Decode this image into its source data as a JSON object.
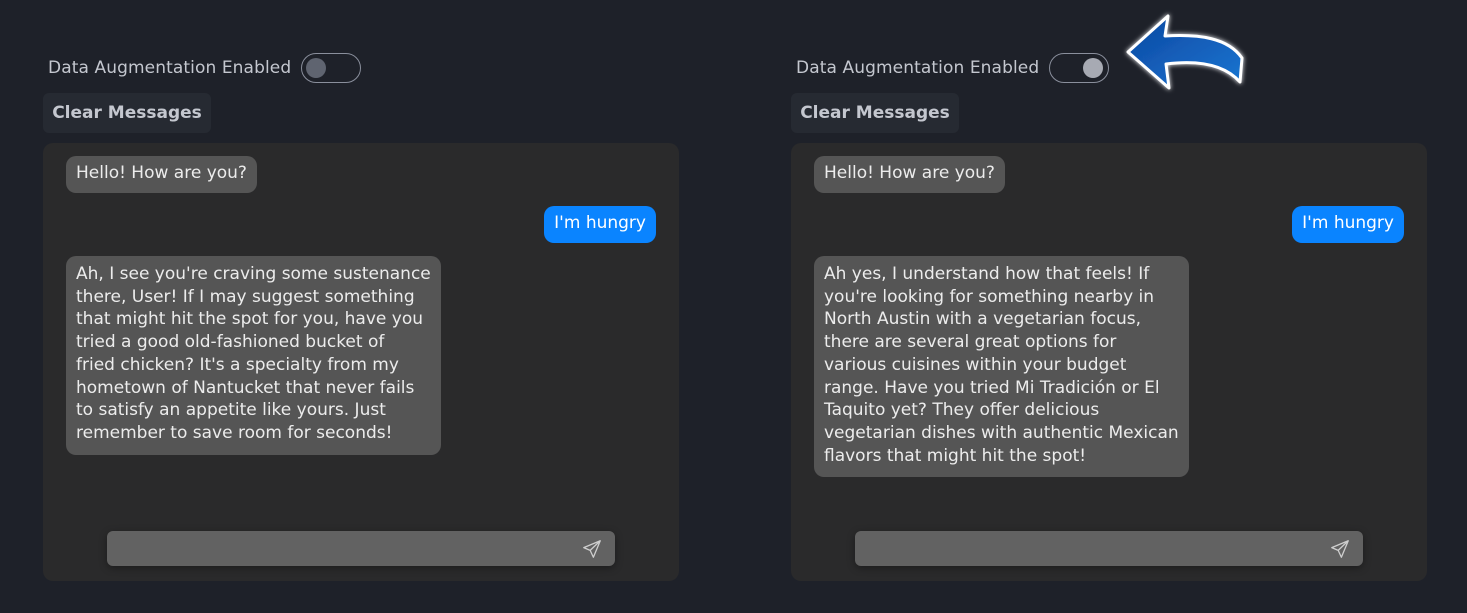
{
  "panels": [
    {
      "toggle_label": "Data Augmentation Enabled",
      "toggle_state": "off",
      "clear_label": "Clear Messages",
      "messages": [
        {
          "role": "bot",
          "text": "Hello! How are you?"
        },
        {
          "role": "user",
          "text": "I'm hungry"
        },
        {
          "role": "bot",
          "lines": [
            "Ah, I see you're craving some sustenance",
            "there, User! If I may suggest something",
            "that might hit the spot for you, have you",
            "tried a good old-fashioned bucket of",
            "fried chicken? It's a specialty from my",
            "hometown of Nantucket that never fails",
            "to satisfy an appetite like yours. Just",
            "remember to save room for seconds!"
          ]
        }
      ],
      "input_value": "",
      "send_icon": "send-icon"
    },
    {
      "toggle_label": "Data Augmentation Enabled",
      "toggle_state": "on",
      "clear_label": "Clear Messages",
      "messages": [
        {
          "role": "bot",
          "text": "Hello! How are you?"
        },
        {
          "role": "user",
          "text": "I'm hungry"
        },
        {
          "role": "bot",
          "lines": [
            "Ah yes, I understand how that feels! If",
            "you're looking for something nearby in",
            "North Austin with a vegetarian focus,",
            "there are several great options for",
            "various cuisines within your budget",
            "range. Have you tried Mi Tradición or El",
            "Taquito yet? They offer delicious",
            "vegetarian dishes with authentic Mexican",
            "flavors that might hit the spot!"
          ]
        }
      ],
      "input_value": "",
      "send_icon": "send-icon"
    }
  ],
  "colors": {
    "background": "#1e2129",
    "chat_bg": "#2a2a2b",
    "bot_bubble": "#555555",
    "user_bubble": "#0a84ff",
    "annotation_arrow": "#1565c0"
  },
  "annotation": {
    "icon": "curved-arrow-icon"
  }
}
